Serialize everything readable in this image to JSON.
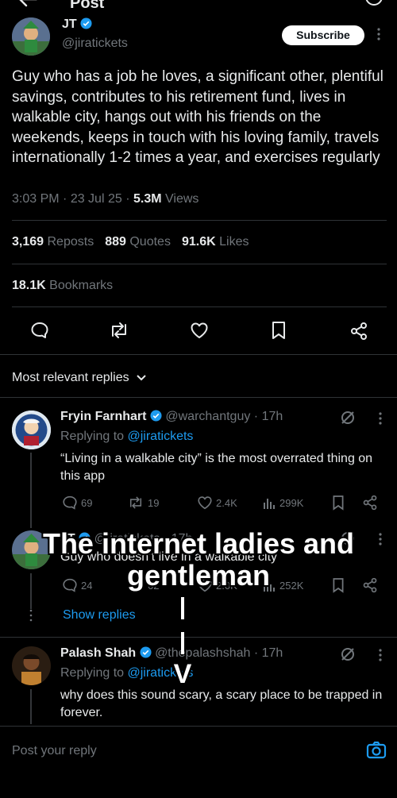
{
  "header": {
    "title": "Post"
  },
  "post": {
    "author_name": "JT",
    "handle": "@jiratickets",
    "subscribe_label": "Subscribe",
    "text": "Guy who has a job he loves, a significant other, plentiful savings, contributes to his retirement fund, lives in walkable city, hangs out with his friends on the weekends, keeps in touch with his loving family, travels internationally 1-2 times a year, and exercises regularly",
    "time": "3:03 PM",
    "date": "23 Jul 25",
    "views_count": "5.3M",
    "views_label": "Views",
    "reposts_count": "3,169",
    "reposts_label": "Reposts",
    "quotes_count": "889",
    "quotes_label": "Quotes",
    "likes_count": "91.6K",
    "likes_label": "Likes",
    "bookmarks_count": "18.1K",
    "bookmarks_label": "Bookmarks"
  },
  "replies_header": {
    "label": "Most relevant replies"
  },
  "replies": [
    {
      "name": "Fryin Farnhart",
      "handle": "@warchantguy",
      "time": "17h",
      "replying_prefix": "Replying to",
      "replying_to": "@jiratickets",
      "text": "“Living in a walkable city” is the most overrated thing on this app",
      "comments": "69",
      "reposts": "19",
      "likes": "2.4K",
      "views": "299K"
    },
    {
      "name": "JT",
      "handle": "@jiratickets",
      "time": "17h",
      "text": "Guy who doesn’t live in a walkable city",
      "comments": "24",
      "reposts": "62",
      "likes": "2.0K",
      "views": "252K",
      "show_replies": "Show replies"
    },
    {
      "name": "Palash Shah",
      "handle": "@thepalashshah",
      "time": "17h",
      "replying_prefix": "Replying to",
      "replying_to": "@jiratickets",
      "text": "why does this sound scary, a scary place to be trapped in forever."
    }
  ],
  "overlay": {
    "line1": "The internet ladies and",
    "line2": "gentleman",
    "arrow_head": "V"
  },
  "composer": {
    "placeholder": "Post your reply"
  },
  "colors": {
    "accent": "#1d9bf0",
    "background": "#000000",
    "text": "#e7e9ea",
    "muted": "#71767b",
    "divider": "#2f3336"
  }
}
